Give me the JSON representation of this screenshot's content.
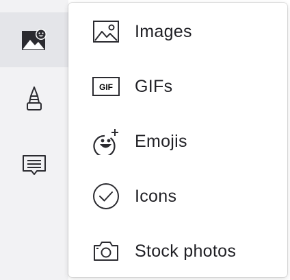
{
  "left_rail": {
    "items": [
      {
        "icon": "image-sticker-icon",
        "active": true
      },
      {
        "icon": "lighthouse-icon",
        "active": false
      },
      {
        "icon": "speech-bubble-icon",
        "active": false
      }
    ]
  },
  "menu": {
    "items": [
      {
        "label": "Images",
        "icon": "image-icon"
      },
      {
        "label": "GIFs",
        "icon": "gif-icon",
        "icon_text": "GIF"
      },
      {
        "label": "Emojis",
        "icon": "emoji-add-icon"
      },
      {
        "label": "Icons",
        "icon": "check-circle-icon"
      },
      {
        "label": "Stock photos",
        "icon": "camera-icon"
      }
    ]
  },
  "colors": {
    "rail_background": "#f2f2f4",
    "rail_active": "#e4e5e9",
    "menu_background": "#ffffff",
    "text": "#1f1f24",
    "icon": "#2b2b30"
  }
}
